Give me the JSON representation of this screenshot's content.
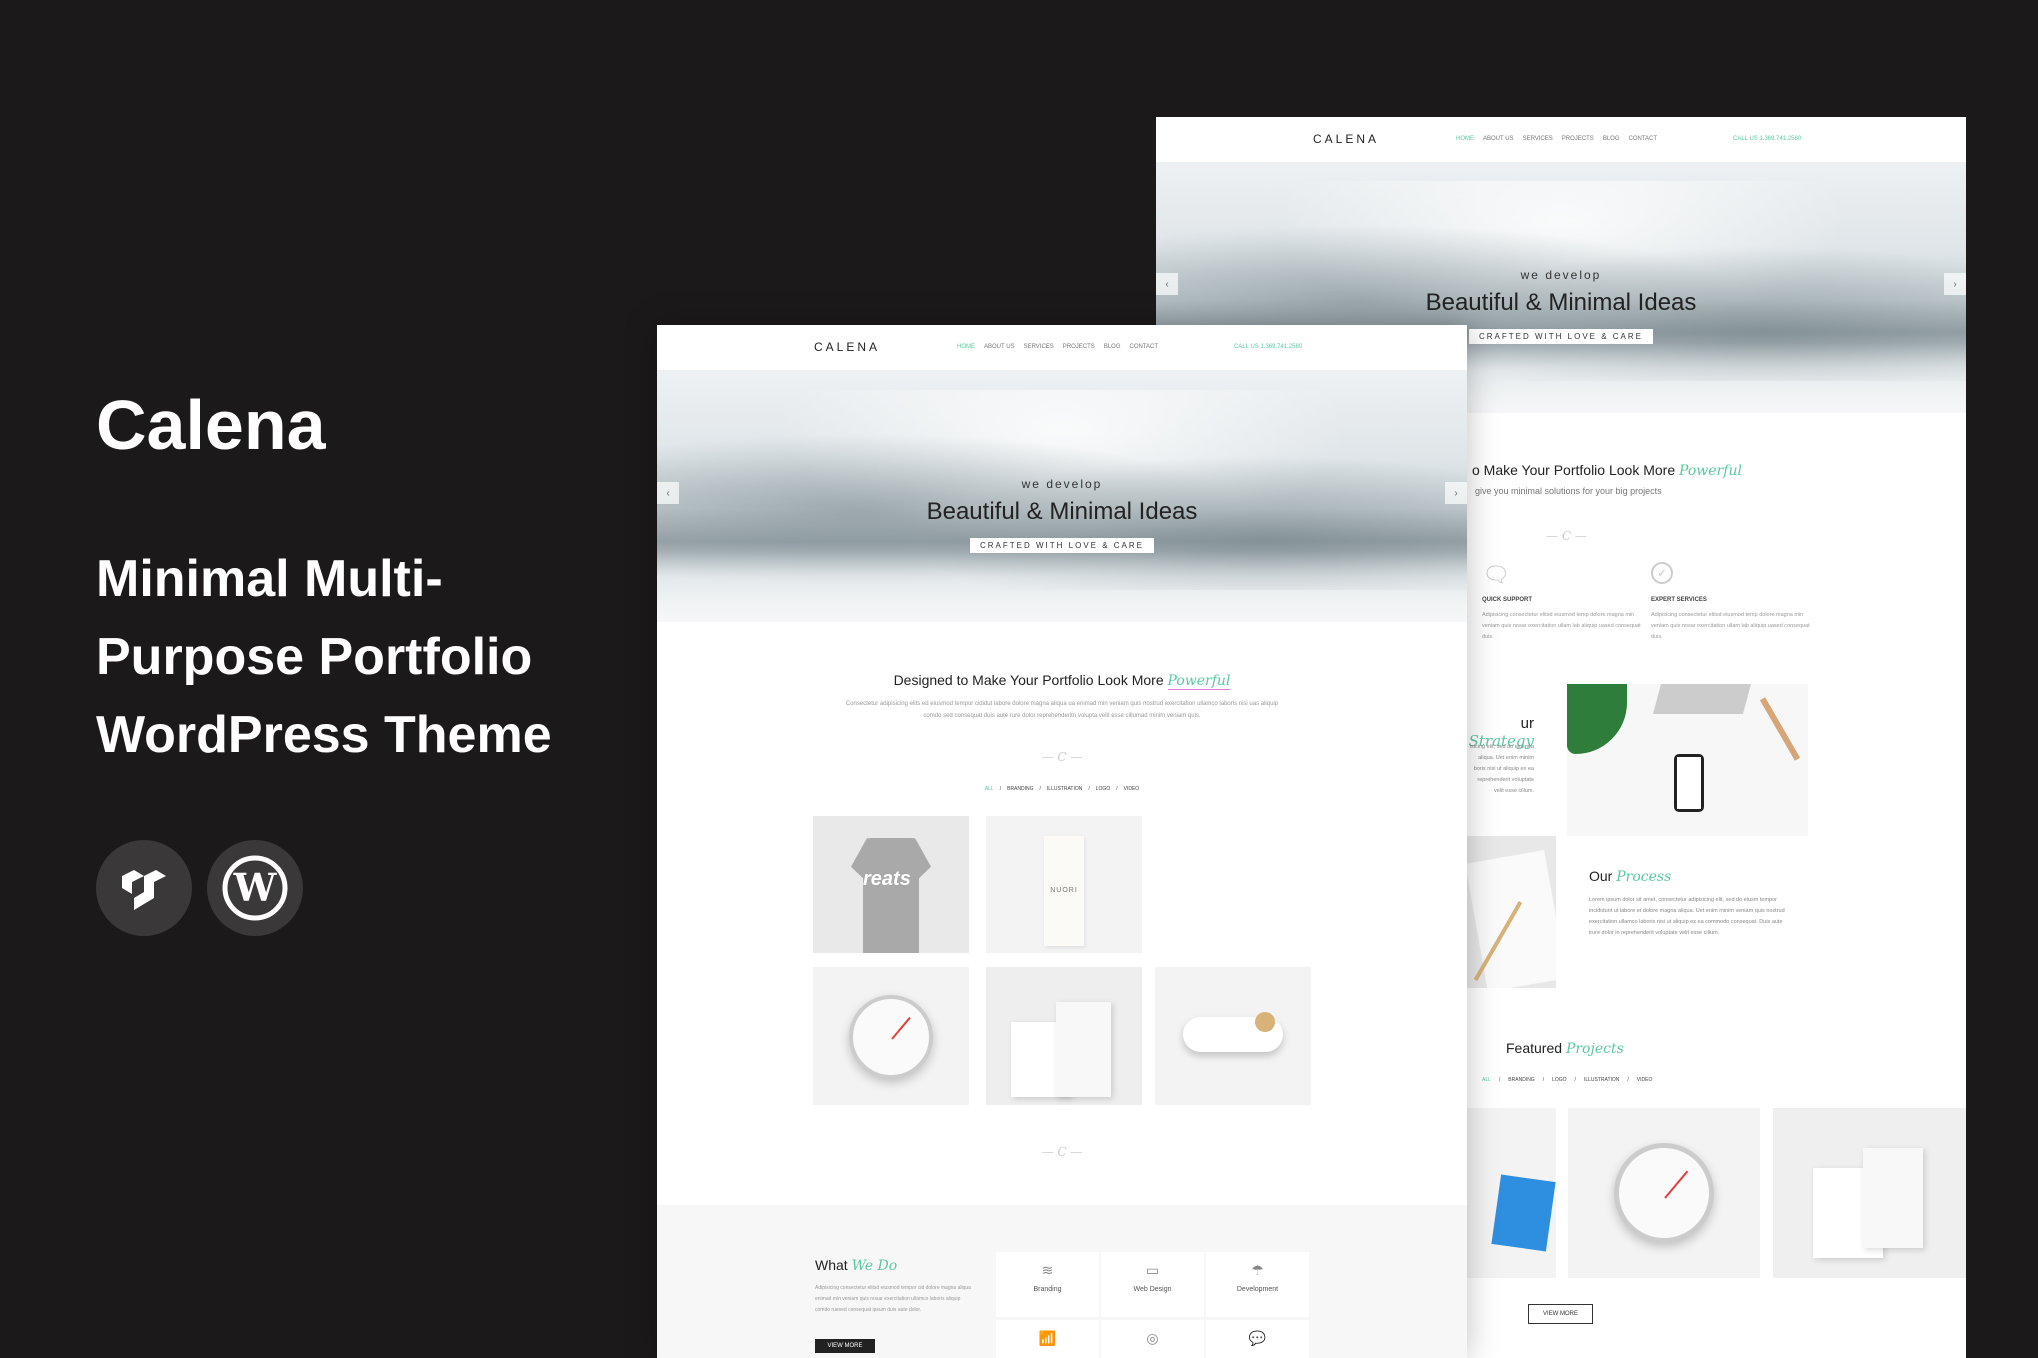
{
  "promo": {
    "title": "Calena",
    "tagline": "Minimal Multi-Purpose Portfolio WordPress Theme",
    "badges": [
      "themeforest-icon",
      "wordpress-icon"
    ]
  },
  "nav": {
    "logo": "CALENA",
    "links": [
      "HOME",
      "ABOUT US",
      "SERVICES",
      "PROJECTS",
      "BLOG",
      "CONTACT"
    ],
    "call": "CALL US 1.369.741.2580"
  },
  "hero": {
    "small": "we develop",
    "title": "Beautiful & Minimal Ideas",
    "badge": "CRAFTED WITH LOVE & CARE",
    "prev": "‹",
    "next": "›"
  },
  "accent": "#5bc8a0",
  "front": {
    "heading": "Designed to Make Your Portfolio Look More ",
    "heading_accent": "Powerful",
    "paragraph": "Consectetur adipisicing elits ed eiusmod tempor cididut labore dolore magna aliqua ua enimad min veniam quis nostrud exercitation ullamco laboris nisi uas aliquip comdo sed consequat duis aute rure dolor reprehenderitn volupta velit esse cillumad minim veniam quis.",
    "divider": "— C —",
    "filters": [
      "ALL",
      "/",
      "BRANDING",
      "/",
      "ILLUSTRATION",
      "/",
      "LOGO",
      "/",
      "VIDEO"
    ],
    "tee_text": "reats",
    "bottle_text": "NUORI",
    "what": "What ",
    "what_accent": "We Do",
    "what_text": "Adipisicing consectetur elitsd eiusmod tempor cid dolore magna aliqua enimad min veniam quis nosar exercitation ullamco laboris aliquip comdo ruesed consequat ipsum duis aute dolor.",
    "view_more": "VIEW MORE",
    "services": [
      {
        "label": "Branding",
        "icon": "layers-icon",
        "glyph": "≋"
      },
      {
        "label": "Web Design",
        "icon": "monitor-icon",
        "glyph": "▭"
      },
      {
        "label": "Development",
        "icon": "umbrella-icon",
        "glyph": "☂"
      },
      {
        "label": "",
        "icon": "chart-icon",
        "glyph": "📶"
      },
      {
        "label": "",
        "icon": "camera-icon",
        "glyph": "◎"
      },
      {
        "label": "",
        "icon": "chat-icon",
        "glyph": "💬"
      }
    ]
  },
  "back": {
    "heading": "o Make Your Portfolio Look More ",
    "heading_accent": "Powerful",
    "sub": "give you minimal solutions for your big projects",
    "features": [
      {
        "title": "QUICK SUPPORT",
        "text": "Adipisicing consectetur elitsd eiusmod temp dolore magna min veniam quis nosar exercitation ullam lab aliquip uased consequat duis."
      },
      {
        "title": "EXPERT SERVICES",
        "text": "Adipisicing consectetur elitsd eiusmod temp dolore magna min veniam quis nosar exercitation ullam lab aliquip uased consequat duis."
      }
    ],
    "strategy": "ur ",
    "strategy_accent": "Strategy",
    "strategy_text": "isicing elit, sed do eiusm a aliqua. Uet enim minim boris nisi ut aliquip ex ea reprehenderit voluptate velit esse cillum.",
    "process": "Our ",
    "process_accent": "Process",
    "process_text": "Lorem ipsum dolor sit amet, consectetur adipisicing elit, sed do eiusm tempor incididunt ut labore et dolore magna aliqua. Uet enim minim veniam quis nostrud exercitation ullamco laboris nisi ut aliquip ex ea commodo consequat. Duis aute irure dolor in reprehenderit voluptate velit esse cillum.",
    "featured": "Featured ",
    "featured_accent": "Projects",
    "filters": [
      "ALL",
      "/",
      "BRANDING",
      "/",
      "LOGO",
      "/",
      "ILLUSTRATION",
      "/",
      "VIDEO"
    ],
    "view_more": "VIEW MORE"
  }
}
